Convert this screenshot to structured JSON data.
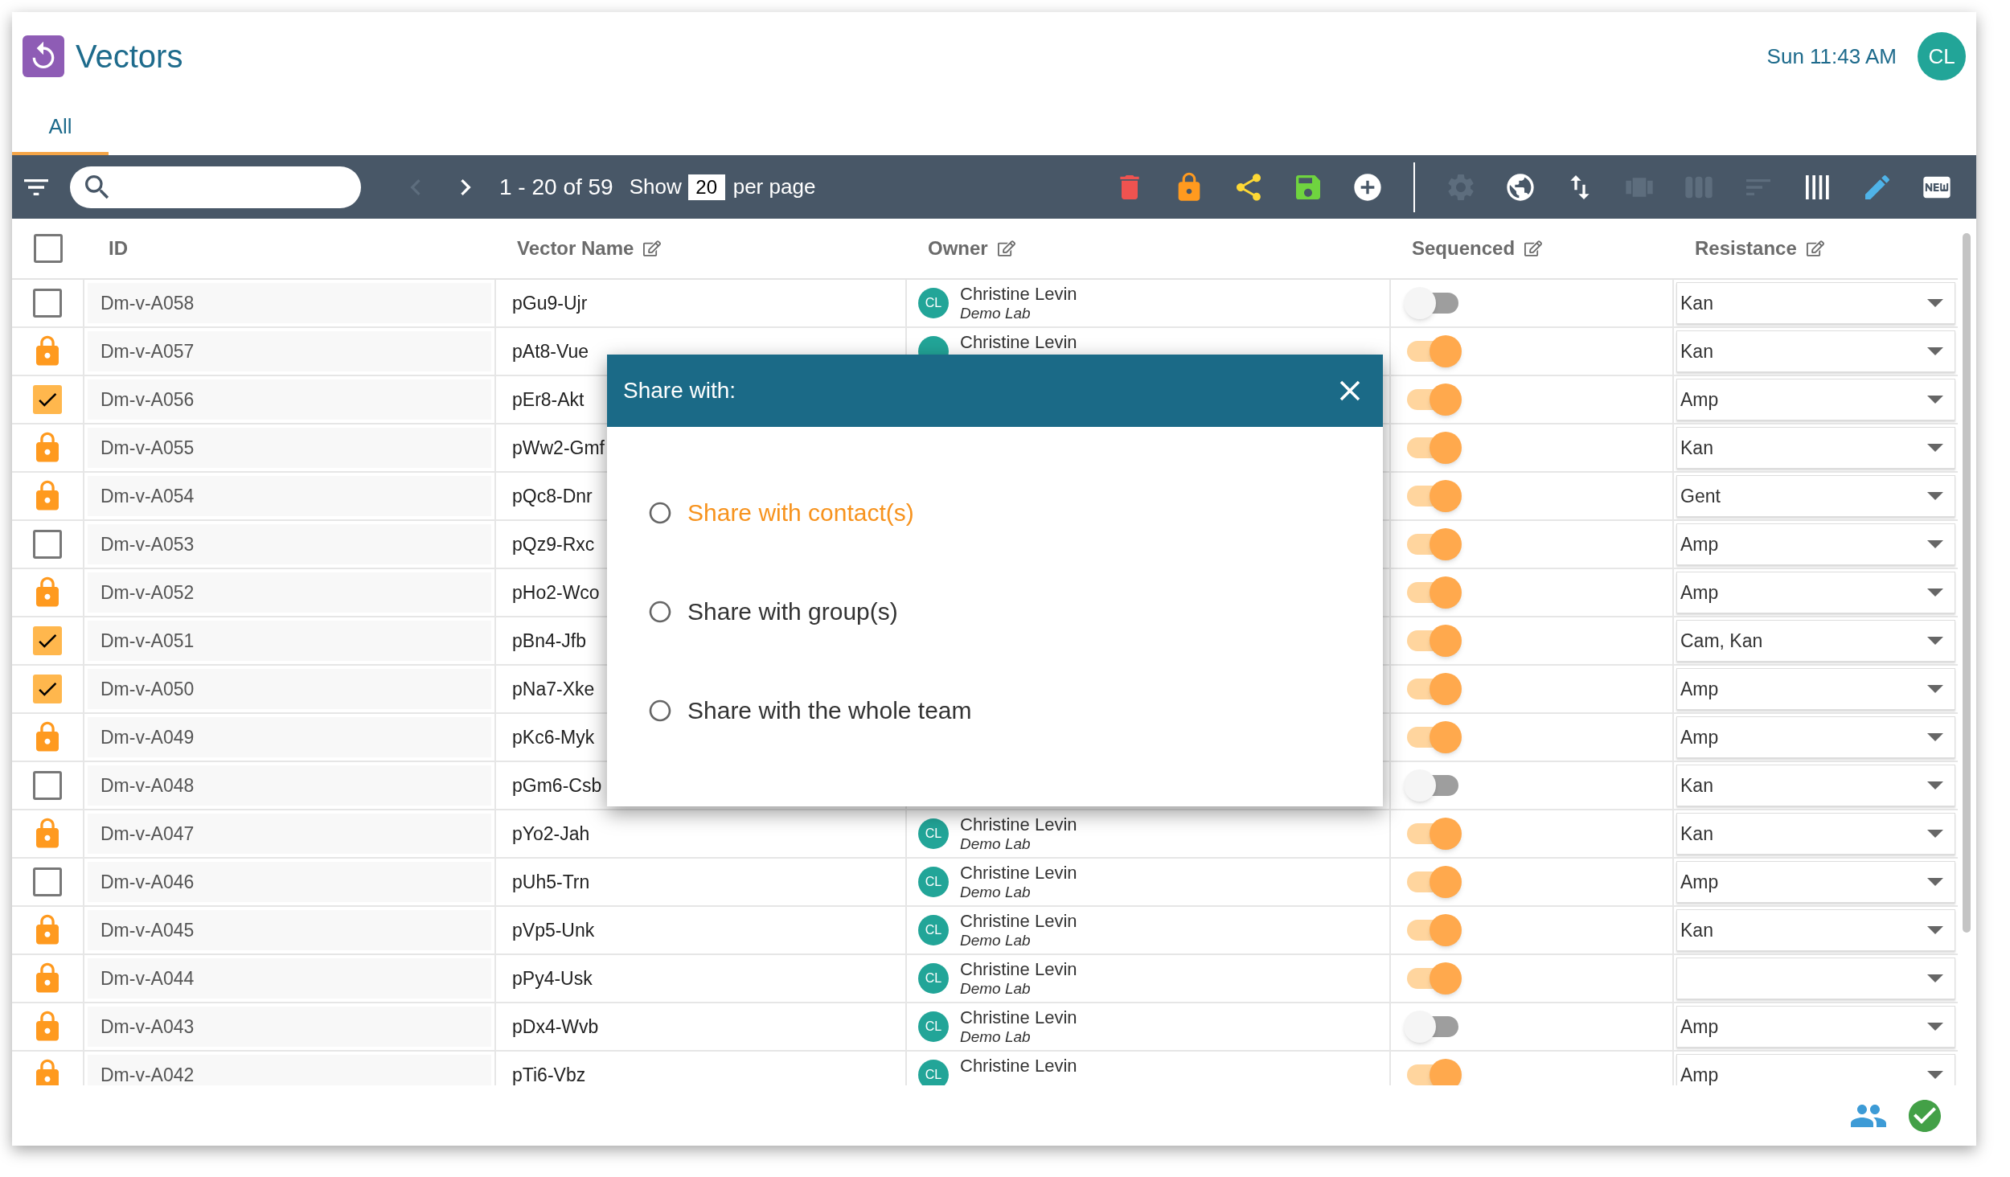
{
  "app": {
    "title": "Vectors",
    "clock": "Sun 11:43 AM",
    "user_initials": "CL"
  },
  "tabs": [
    {
      "label": "All",
      "selected": true
    }
  ],
  "pagination": {
    "prev_disabled": true,
    "next_disabled": false,
    "range": "1 - 20 of 59",
    "show_label": "Show",
    "per_page": "20",
    "per_page_label": "per page"
  },
  "actions": [
    {
      "kind": "delete",
      "disabled": false
    },
    {
      "kind": "lock",
      "disabled": false
    },
    {
      "kind": "share",
      "disabled": false
    },
    {
      "kind": "save",
      "disabled": false
    },
    {
      "kind": "add",
      "disabled": false
    },
    {
      "kind": "settings",
      "disabled": true
    },
    {
      "kind": "globe",
      "disabled": false
    },
    {
      "kind": "sort",
      "disabled": false
    },
    {
      "kind": "carousel",
      "disabled": true
    },
    {
      "kind": "columns",
      "disabled": true
    },
    {
      "kind": "lines",
      "disabled": true
    },
    {
      "kind": "barcode",
      "disabled": false
    },
    {
      "kind": "edit",
      "disabled": false
    },
    {
      "kind": "new",
      "disabled": false
    }
  ],
  "select_all": {
    "checked": false
  },
  "columns": [
    {
      "label": "ID",
      "editable": false
    },
    {
      "label": "Vector Name",
      "editable": true
    },
    {
      "label": "Owner",
      "editable": true
    },
    {
      "label": "Sequenced",
      "editable": true
    },
    {
      "label": "Resistance",
      "editable": true
    }
  ],
  "rows": [
    {
      "kind": "checkbox",
      "checked": false,
      "id": "Dm-v-A058",
      "name": "pGu9-Ujr",
      "owner": {
        "initials": "CL",
        "name": "Christine Levin",
        "lab": "Demo Lab"
      },
      "sequenced": false,
      "resistance": "Kan"
    },
    {
      "kind": "locked",
      "id": "Dm-v-A057",
      "name": "pAt8-Vue",
      "owner": {
        "name": "Christine Levin"
      },
      "sequenced": true,
      "resistance": "Kan"
    },
    {
      "kind": "checkbox",
      "checked": true,
      "id": "Dm-v-A056",
      "name": "pEr8-Akt",
      "sequenced": true,
      "resistance": "Amp"
    },
    {
      "kind": "locked",
      "id": "Dm-v-A055",
      "name": "pWw2-Gmf",
      "sequenced": true,
      "resistance": "Kan"
    },
    {
      "kind": "locked",
      "id": "Dm-v-A054",
      "name": "pQc8-Dnr",
      "sequenced": true,
      "resistance": "Gent"
    },
    {
      "kind": "checkbox",
      "checked": false,
      "id": "Dm-v-A053",
      "name": "pQz9-Rxc",
      "sequenced": true,
      "resistance": "Amp"
    },
    {
      "kind": "locked",
      "id": "Dm-v-A052",
      "name": "pHo2-Wco",
      "sequenced": true,
      "resistance": "Amp"
    },
    {
      "kind": "checkbox",
      "checked": true,
      "id": "Dm-v-A051",
      "name": "pBn4-Jfb",
      "sequenced": true,
      "resistance": "Cam, Kan"
    },
    {
      "kind": "checkbox",
      "checked": true,
      "id": "Dm-v-A050",
      "name": "pNa7-Xke",
      "sequenced": true,
      "resistance": "Amp"
    },
    {
      "kind": "locked",
      "id": "Dm-v-A049",
      "name": "pKc6-Myk",
      "sequenced": true,
      "resistance": "Amp"
    },
    {
      "kind": "checkbox",
      "checked": false,
      "id": "Dm-v-A048",
      "name": "pGm6-Csb",
      "sequenced": false,
      "resistance": "Kan"
    },
    {
      "kind": "locked",
      "id": "Dm-v-A047",
      "name": "pYo2-Jah",
      "owner": {
        "initials": "CL",
        "name": "Christine Levin",
        "lab": "Demo Lab"
      },
      "sequenced": true,
      "resistance": "Kan"
    },
    {
      "kind": "checkbox",
      "checked": false,
      "id": "Dm-v-A046",
      "name": "pUh5-Trn",
      "owner": {
        "initials": "CL",
        "name": "Christine Levin",
        "lab": "Demo Lab"
      },
      "sequenced": true,
      "resistance": "Amp"
    },
    {
      "kind": "locked",
      "id": "Dm-v-A045",
      "name": "pVp5-Unk",
      "owner": {
        "initials": "CL",
        "name": "Christine Levin",
        "lab": "Demo Lab"
      },
      "sequenced": true,
      "resistance": "Kan"
    },
    {
      "kind": "locked",
      "id": "Dm-v-A044",
      "name": "pPy4-Usk",
      "owner": {
        "initials": "CL",
        "name": "Christine Levin",
        "lab": "Demo Lab"
      },
      "sequenced": true
    },
    {
      "kind": "locked",
      "id": "Dm-v-A043",
      "name": "pDx4-Wvb",
      "owner": {
        "initials": "CL",
        "name": "Christine Levin",
        "lab": "Demo Lab"
      },
      "sequenced": false,
      "resistance": "Amp"
    },
    {
      "kind": "locked",
      "id": "Dm-v-A042",
      "name": "pTi6-Vbz",
      "owner": {
        "initials": "CL",
        "name": "Christine Levin"
      },
      "sequenced": true,
      "resistance": "Amp"
    }
  ],
  "dialog": {
    "title": "Share with:",
    "options": [
      {
        "label": "Share with contact(s)",
        "selected": false,
        "highlighted": true
      },
      {
        "label": "Share with group(s)",
        "selected": false,
        "highlighted": false
      },
      {
        "label": "Share with the whole team",
        "selected": false,
        "highlighted": false
      }
    ]
  }
}
